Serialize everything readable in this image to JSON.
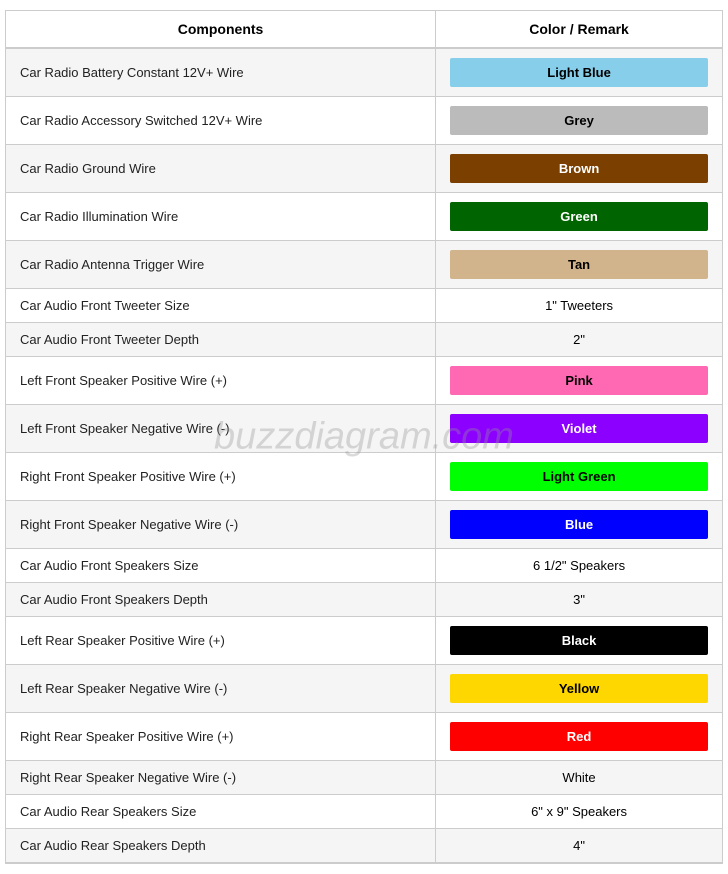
{
  "table": {
    "headers": [
      "Components",
      "Color / Remark"
    ],
    "rows": [
      {
        "component": "Car Radio Battery Constant 12V+ Wire",
        "color_label": "Light Blue",
        "color_hex": "#87CEEB",
        "text_color": "#000000",
        "has_bg": true
      },
      {
        "component": "Car Radio Accessory Switched 12V+ Wire",
        "color_label": "Grey",
        "color_hex": "#BBBBBB",
        "text_color": "#000000",
        "has_bg": true
      },
      {
        "component": "Car Radio Ground Wire",
        "color_label": "Brown",
        "color_hex": "#7B3F00",
        "text_color": "#FFFFFF",
        "has_bg": true
      },
      {
        "component": "Car Radio Illumination Wire",
        "color_label": "Green",
        "color_hex": "#006400",
        "text_color": "#FFFFFF",
        "has_bg": true
      },
      {
        "component": "Car Radio Antenna Trigger Wire",
        "color_label": "Tan",
        "color_hex": "#D2B48C",
        "text_color": "#000000",
        "has_bg": true
      },
      {
        "component": "Car Audio Front Tweeter Size",
        "color_label": "1\" Tweeters",
        "color_hex": null,
        "text_color": "#000000",
        "has_bg": false
      },
      {
        "component": "Car Audio Front Tweeter Depth",
        "color_label": "2\"",
        "color_hex": null,
        "text_color": "#000000",
        "has_bg": false
      },
      {
        "component": "Left Front Speaker Positive Wire (+)",
        "color_label": "Pink",
        "color_hex": "#FF69B4",
        "text_color": "#000000",
        "has_bg": true
      },
      {
        "component": "Left Front Speaker Negative Wire (-)",
        "color_label": "Violet",
        "color_hex": "#8B00FF",
        "text_color": "#FFFFFF",
        "has_bg": true
      },
      {
        "component": "Right Front Speaker Positive Wire (+)",
        "color_label": "Light Green",
        "color_hex": "#00FF00",
        "text_color": "#000000",
        "has_bg": true
      },
      {
        "component": "Right Front Speaker Negative Wire (-)",
        "color_label": "Blue",
        "color_hex": "#0000FF",
        "text_color": "#FFFFFF",
        "has_bg": true
      },
      {
        "component": "Car Audio Front Speakers Size",
        "color_label": "6 1/2\" Speakers",
        "color_hex": null,
        "text_color": "#000000",
        "has_bg": false
      },
      {
        "component": "Car Audio Front Speakers Depth",
        "color_label": "3\"",
        "color_hex": null,
        "text_color": "#000000",
        "has_bg": false
      },
      {
        "component": "Left Rear Speaker Positive Wire (+)",
        "color_label": "Black",
        "color_hex": "#000000",
        "text_color": "#FFFFFF",
        "has_bg": true
      },
      {
        "component": "Left Rear Speaker Negative Wire (-)",
        "color_label": "Yellow",
        "color_hex": "#FFD700",
        "text_color": "#000000",
        "has_bg": true
      },
      {
        "component": "Right Rear Speaker Positive Wire (+)",
        "color_label": "Red",
        "color_hex": "#FF0000",
        "text_color": "#FFFFFF",
        "has_bg": true
      },
      {
        "component": "Right Rear Speaker Negative Wire (-)",
        "color_label": "White",
        "color_hex": null,
        "text_color": "#000000",
        "has_bg": false
      },
      {
        "component": "Car Audio Rear Speakers Size",
        "color_label": "6\" x 9\" Speakers",
        "color_hex": null,
        "text_color": "#000000",
        "has_bg": false
      },
      {
        "component": "Car Audio Rear Speakers Depth",
        "color_label": "4\"",
        "color_hex": null,
        "text_color": "#000000",
        "has_bg": false
      }
    ]
  },
  "watermark": "buzzdiagram.com"
}
